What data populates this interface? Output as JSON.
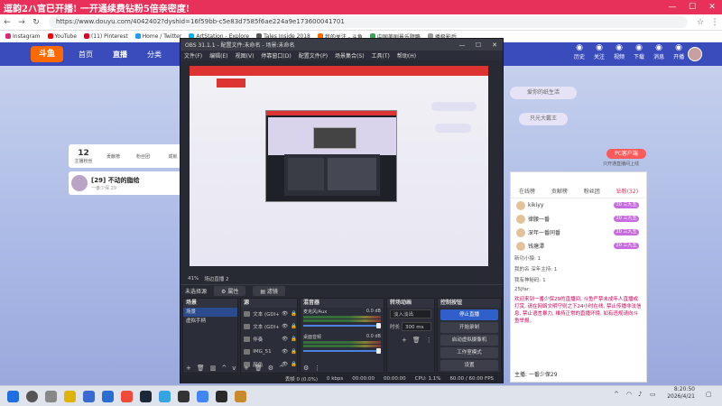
{
  "browser": {
    "tab_title": "逗韵2ハ官已开播! 一开通续费钻粉5倍亲密度!",
    "url": "https://www.douyu.com/4042402?dyshid=16f59bb-c5e83d7585f6ae224a9e173600041701",
    "bookmarks": [
      "Instagram",
      "YouTube",
      "(11) Pinterest",
      "Home / Twitter",
      "ArtStation - Explore",
      "Tales Inside 2018",
      "我的关注 - 斗鱼",
      "中国美剧景乐题略",
      "播极影后"
    ],
    "bookmark_colors": [
      "#d62976",
      "#ff0000",
      "#e60023",
      "#1d9bf0",
      "#13aff0",
      "#555555",
      "#ff6a00",
      "#3aa757",
      "#999999"
    ]
  },
  "site": {
    "logo": "斗鱼",
    "nav": [
      "首页",
      "直播",
      "分类",
      "赛事",
      "游戏"
    ],
    "right_icons": [
      {
        "icon": "history-icon",
        "label": "历史"
      },
      {
        "icon": "follow-icon",
        "label": "关注"
      },
      {
        "icon": "video-icon",
        "label": "视频"
      },
      {
        "icon": "download-icon",
        "label": "下载"
      },
      {
        "icon": "message-icon",
        "label": "消息"
      },
      {
        "icon": "upload-icon",
        "label": "开播"
      }
    ],
    "banner_a": "爱你的纸生活",
    "banner_b": "只光大戴王",
    "stats": [
      {
        "value": "12",
        "label": "主播粉丝"
      },
      {
        "value": "",
        "label": "贡献榜"
      },
      {
        "value": "",
        "label": "粉丝团"
      },
      {
        "value": "",
        "label": "成就"
      }
    ],
    "room_number": "[29]",
    "room_title": "不动的脂给",
    "room_meta": "一番少保 29",
    "pc_client": "PC客户端",
    "pc_sub": "只开通直播间上线",
    "chat_tabs": [
      "在线榜",
      "贡献榜",
      "粉丝团",
      "钻粉(32)"
    ],
    "ranks": [
      {
        "name": "kikiyy",
        "badge": "20 三九五"
      },
      {
        "name": "律腰一番",
        "badge": "20 三九五"
      },
      {
        "name": "深年一番同番",
        "badge": "20 三九五"
      },
      {
        "name": "钱塘潭",
        "badge": "20 三九五"
      }
    ],
    "chat_lines": [
      "新功小猿: 1",
      "我的名 深年主持: 1",
      "我有神秘码: 1",
      "25Jfar:"
    ],
    "chat_block": "欢迎来到一番少保29的直播间, 斗鱼严禁未成年人直播或打赏, 请在网络文明守则之下24小时在线, 禁止传播非法信息, 禁止语言暴力, 维持正常的直播环境, 如有违规请向斗鱼举报。",
    "chat_bottom": "主播: 一番少保29"
  },
  "obs": {
    "title": "OBS 31.1.1 - 配置文件:未命名 - 场景:未命名",
    "menu": [
      "文件(F)",
      "编辑(E)",
      "视图(V)",
      "停靠窗口(D)",
      "配置文件(P)",
      "场景集合(S)",
      "工具(T)",
      "帮助(H)"
    ],
    "zoom": "41%",
    "status_selected": "场边直播 2",
    "no_source": "未选择源",
    "toolbar": {
      "props": "属性",
      "filters": "滤镜"
    },
    "scenes_title": "场景",
    "scenes": [
      "场景",
      "虚拟手柄"
    ],
    "sources_title": "源",
    "sources": [
      "文本 (GDI+)",
      "文本 (GDI+)",
      "伴奏",
      "IMG_51",
      "颜色"
    ],
    "mixer_title": "混音器",
    "mixer": [
      {
        "name": "麦克风/Aux",
        "level": "0.0 dB"
      },
      {
        "name": "桌面音频",
        "level": "0.0 dB"
      }
    ],
    "transitions_title": "转场动画",
    "transition_value": "淡入淡出",
    "duration_label": "时长",
    "duration_value": "300 ms",
    "controls_title": "控制按钮",
    "controls": [
      "停止直播",
      "开始录制",
      "启动虚拟摄像机",
      "工作室模式",
      "设置"
    ],
    "status": {
      "dropped": "丢帧 0 (0.0%)",
      "bitrate": "0 kbps",
      "live": "00:00:00",
      "rec": "00:00:00",
      "cpu": "CPU: 1.1%",
      "fps": "60.00 / 60.00 FPS"
    }
  },
  "taskbar": {
    "time": "8:20:50",
    "date": "2026/4/21"
  }
}
